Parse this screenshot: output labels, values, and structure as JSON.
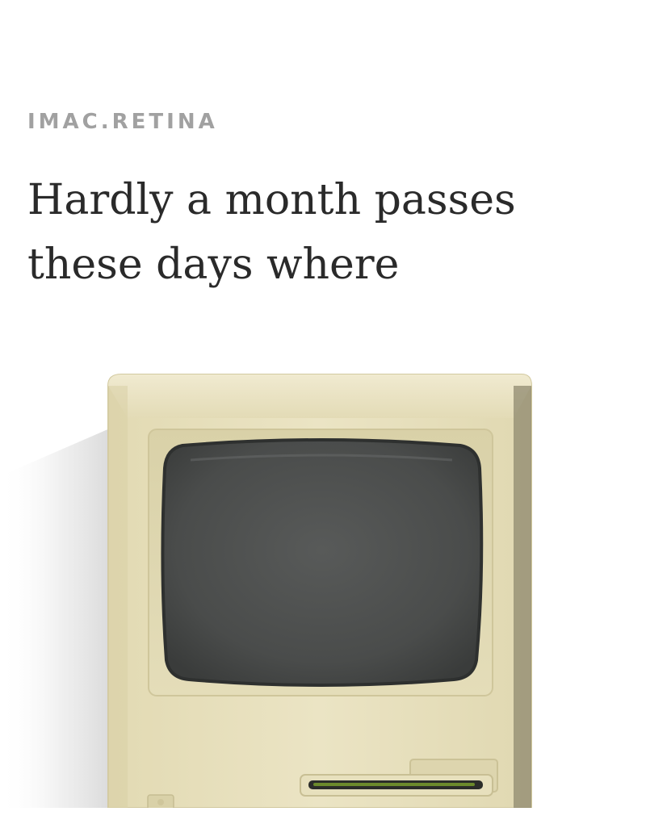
{
  "article": {
    "category": "IMAC.RETINA",
    "headline": "Hardly a month passes these days where",
    "image_icon": "retro-macintosh-computer"
  },
  "colors": {
    "background": "#ffffff",
    "category_text": "#a1a1a1",
    "headline_text": "#2a2a2a",
    "computer_body": "#e6dfba",
    "screen": "#4b4d4c",
    "drive_slot_accent": "#6c8a2c"
  }
}
